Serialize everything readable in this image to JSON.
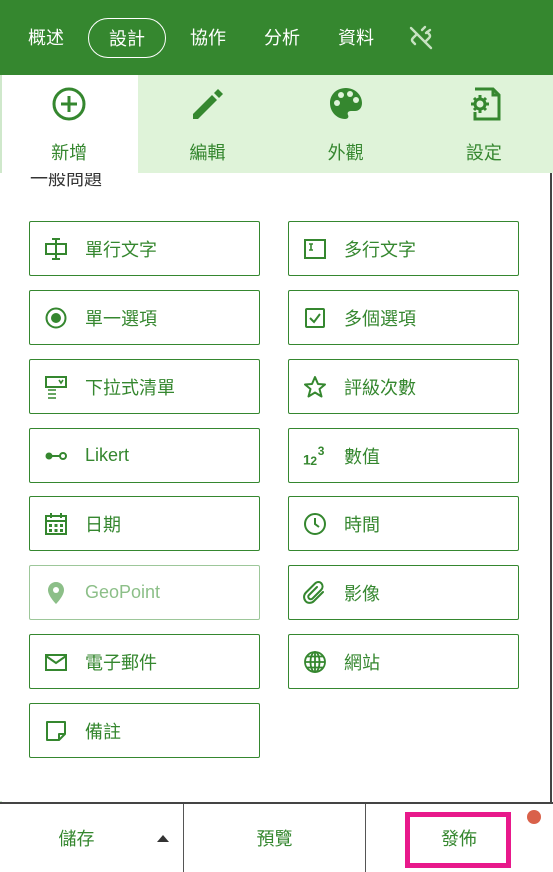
{
  "topnav": {
    "tabs": [
      "概述",
      "設計",
      "協作",
      "分析",
      "資料"
    ],
    "active_index": 1,
    "extra_icon": "disconnect-icon"
  },
  "subtabs": [
    {
      "label": "新增",
      "icon": "add-circle-icon",
      "active": true
    },
    {
      "label": "編輯",
      "icon": "pencil-icon",
      "active": false
    },
    {
      "label": "外觀",
      "icon": "palette-icon",
      "active": false
    },
    {
      "label": "設定",
      "icon": "settings-page-icon",
      "active": false
    }
  ],
  "section_title": "一般問題",
  "questions": [
    {
      "label": "單行文字",
      "icon": "single-line-text-icon"
    },
    {
      "label": "多行文字",
      "icon": "multi-line-text-icon"
    },
    {
      "label": "單一選項",
      "icon": "radio-icon"
    },
    {
      "label": "多個選項",
      "icon": "checkbox-icon"
    },
    {
      "label": "下拉式清單",
      "icon": "dropdown-icon"
    },
    {
      "label": "評級次數",
      "icon": "star-icon"
    },
    {
      "label": "Likert",
      "icon": "likert-icon"
    },
    {
      "label": "數值",
      "icon": "number-icon"
    },
    {
      "label": "日期",
      "icon": "calendar-icon"
    },
    {
      "label": "時間",
      "icon": "clock-icon"
    },
    {
      "label": "GeoPoint",
      "icon": "map-pin-icon",
      "disabled": true
    },
    {
      "label": "影像",
      "icon": "paperclip-icon"
    },
    {
      "label": "電子郵件",
      "icon": "mail-icon"
    },
    {
      "label": "網站",
      "icon": "globe-icon"
    },
    {
      "label": "備註",
      "icon": "note-icon"
    }
  ],
  "footer": {
    "save_label": "儲存",
    "preview_label": "預覽",
    "publish_label": "發佈"
  },
  "colors": {
    "brand_green": "#35872f",
    "light_green": "#dff3d9",
    "highlight": "#e8198b",
    "notification_dot": "#d9614a"
  }
}
